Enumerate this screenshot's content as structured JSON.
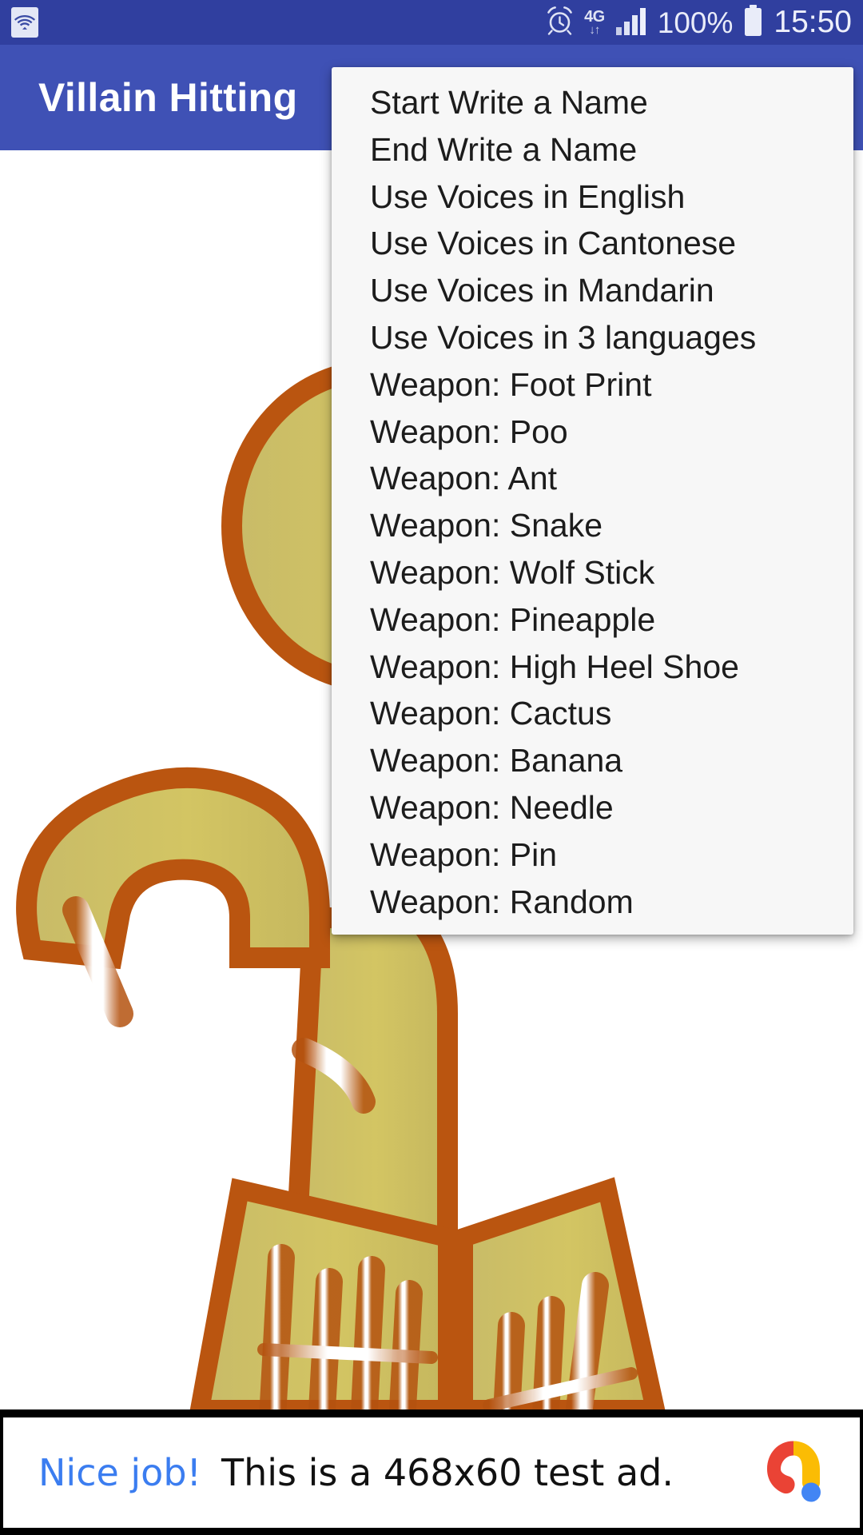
{
  "status_bar": {
    "wifi_icon": "wifi-icon",
    "alarm_icon": "alarm-clock-icon",
    "network_label": "4G",
    "network_arrows": "↓↑",
    "signal_icon": "signal-bars-icon",
    "battery_percent": "100%",
    "battery_icon": "battery-full-icon",
    "time": "15:50",
    "background_color": "#303F9F"
  },
  "app_bar": {
    "title": "Villain Hitting",
    "background_color": "#3F51B5",
    "title_color": "#FFFFFF"
  },
  "overflow_menu": {
    "background_color": "#F7F7F7",
    "text_color": "#1C1C1C",
    "items": [
      {
        "label": "Start Write a Name"
      },
      {
        "label": "End Write a Name"
      },
      {
        "label": "Use Voices in English"
      },
      {
        "label": "Use Voices in Cantonese"
      },
      {
        "label": "Use Voices in Mandarin"
      },
      {
        "label": "Use Voices in 3 languages"
      },
      {
        "label": "Weapon: Foot Print"
      },
      {
        "label": "Weapon: Poo"
      },
      {
        "label": "Weapon: Ant"
      },
      {
        "label": "Weapon: Snake"
      },
      {
        "label": "Weapon: Wolf Stick"
      },
      {
        "label": "Weapon: Pineapple"
      },
      {
        "label": "Weapon: High Heel Shoe"
      },
      {
        "label": "Weapon: Cactus"
      },
      {
        "label": "Weapon: Banana"
      },
      {
        "label": "Weapon: Needle"
      },
      {
        "label": "Weapon: Pin"
      },
      {
        "label": "Weapon: Random"
      }
    ]
  },
  "game_stage": {
    "villain_name": "villain-figure",
    "body_fill_color": "#D0C263",
    "body_outline_color": "#BA5510",
    "highlight_color": "#FFFFFF",
    "background_color": "#FFFFFF"
  },
  "ad_banner": {
    "cta_text": "Nice job!",
    "body_text": "This is a 468x60 test ad.",
    "logo_name": "admob-logo-icon",
    "cta_color": "#3B7DF0",
    "body_color": "#111111",
    "logo_colors": {
      "red": "#EA4335",
      "yellow": "#FBBC04",
      "blue": "#4285F4"
    }
  }
}
